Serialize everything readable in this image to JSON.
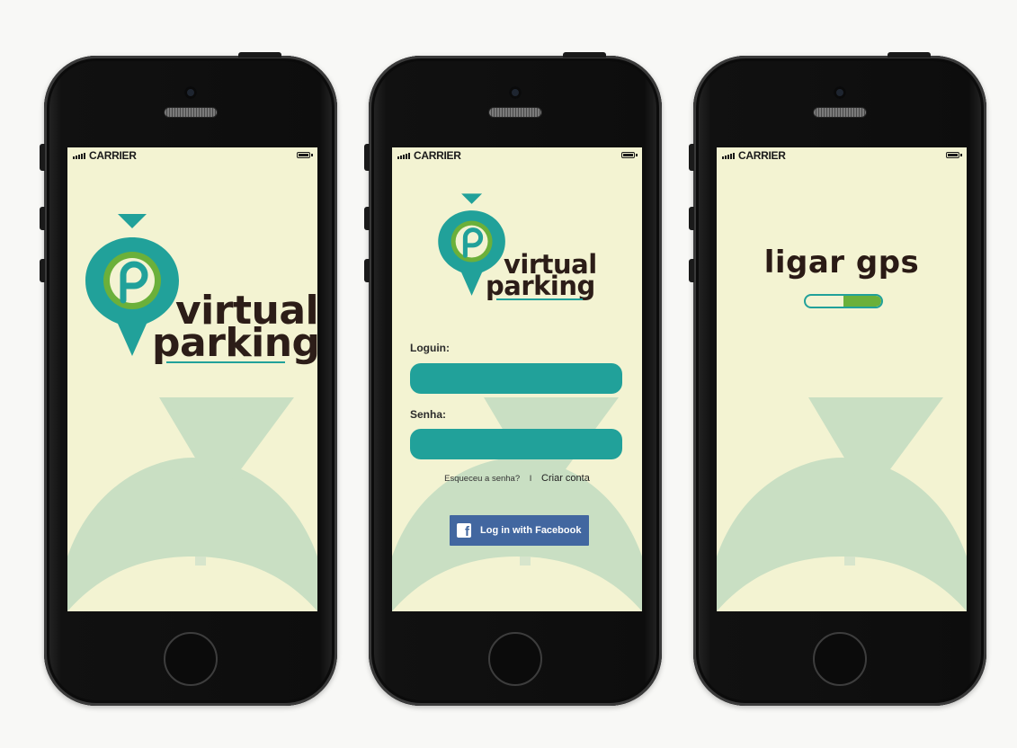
{
  "status": {
    "carrier": "CARRIER"
  },
  "logo": {
    "line1": "virtual",
    "line2": "parking",
    "mark": "P"
  },
  "colors": {
    "screen_bg": "#f3f3d2",
    "teal": "#21a19a",
    "green": "#6bb03a",
    "brown": "#2c1d18",
    "facebook": "#4267a0"
  },
  "login": {
    "login_label": "Loguin:",
    "password_label": "Senha:",
    "forgot_link": "Esqueceu a senha?",
    "separator": "I",
    "create_account_link": "Criar conta",
    "facebook_button": "Log in with Facebook",
    "facebook_icon": "facebook-f-icon"
  },
  "gps": {
    "title": "ligar gps",
    "progress": 0.5
  }
}
